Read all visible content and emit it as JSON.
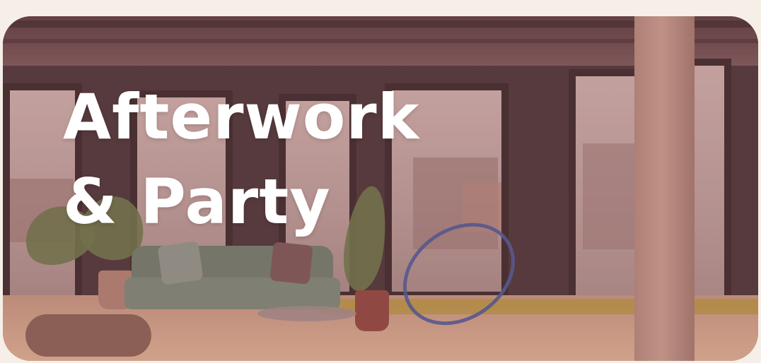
{
  "card": {
    "title_lines": [
      "Afterwork",
      "& Party"
    ]
  },
  "colors": {
    "page_background": "#f6efe8",
    "title_text": "#ffffff",
    "photo_tint": "#964650"
  },
  "image": {
    "semantic": "loft-lounge-photo"
  }
}
